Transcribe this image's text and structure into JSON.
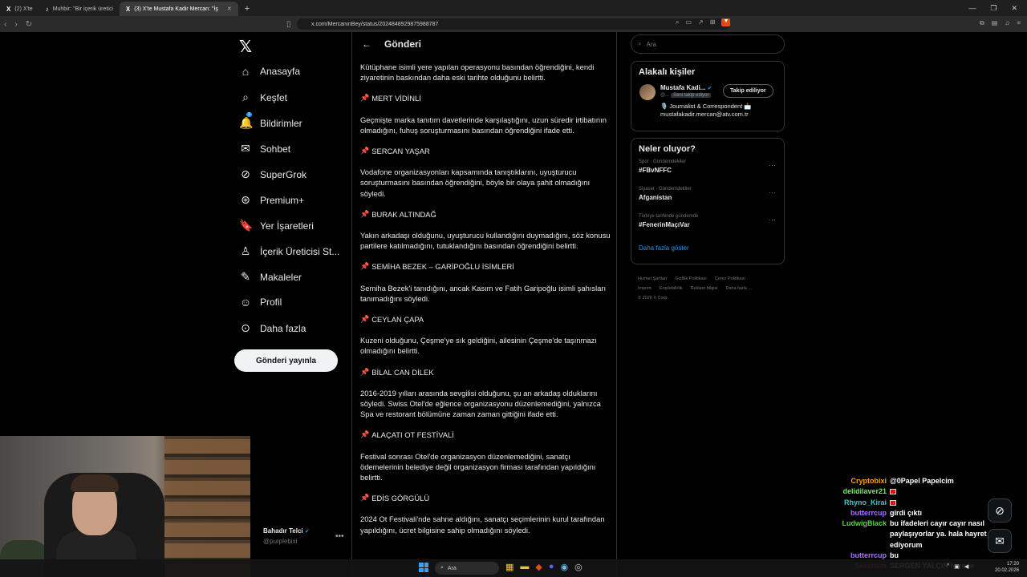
{
  "browser": {
    "tabs": [
      {
        "label": "(2) X'te",
        "active": false
      },
      {
        "label": "Muhbir: \"Bir içerik üretici",
        "active": false
      },
      {
        "label": "(3) X'te Mustafa Kadir Mercan: \"İş",
        "active": true
      }
    ],
    "url": "x.com/MercanınBey/status/2024848929875988787"
  },
  "sidebar": {
    "items": [
      {
        "label": "Anasayfa",
        "icon": "home-icon"
      },
      {
        "label": "Keşfet",
        "icon": "search-icon"
      },
      {
        "label": "Bildirimler",
        "icon": "bell-icon",
        "badge": "3"
      },
      {
        "label": "Sohbet",
        "icon": "mail-icon"
      },
      {
        "label": "SuperGrok",
        "icon": "grok-icon"
      },
      {
        "label": "Premium+",
        "icon": "premium-icon"
      },
      {
        "label": "Yer İşaretleri",
        "icon": "bookmark-icon"
      },
      {
        "label": "İçerik Üreticisi St...",
        "icon": "creator-icon"
      },
      {
        "label": "Makaleler",
        "icon": "article-icon"
      },
      {
        "label": "Profil",
        "icon": "profile-icon"
      },
      {
        "label": "Daha fazla",
        "icon": "more-icon"
      }
    ],
    "post_button": "Gönderi yayınla",
    "account": {
      "name": "Bahadır Telci",
      "handle": "@purplebixi"
    }
  },
  "main": {
    "header": "Gönderi",
    "blocks": [
      {
        "type": "p",
        "text": "Kütüphane isimli yere yapılan operasyonu basından öğrendiğini, kendi ziyaretinin baskından daha eski tarihte olduğunu belirtti."
      },
      {
        "type": "h",
        "text": "MERT VİDİNLİ"
      },
      {
        "type": "p",
        "text": "Geçmişte marka tanıtım davetlerinde karşılaştığını, uzun süredir irtibatının olmadığını, fuhuş soruşturmasını basından öğrendiğini ifade etti."
      },
      {
        "type": "h",
        "text": "SERCAN YAŞAR"
      },
      {
        "type": "p",
        "text": "Vodafone organizasyonları kapsamında tanıştıklarını, uyuşturucu soruşturmasını basından öğrendiğini, böyle bir olaya şahit olmadığını söyledi."
      },
      {
        "type": "h",
        "text": "BURAK ALTINDAĞ"
      },
      {
        "type": "p",
        "text": "Yakın arkadaşı olduğunu, uyuşturucu kullandığını duymadığını, söz konusu partilere katılmadığını, tutuklandığını basından öğrendiğini belirtti."
      },
      {
        "type": "h",
        "text": "SEMİHA BEZEK – GARİPOĞLU İSİMLERİ"
      },
      {
        "type": "p",
        "text": "Semiha Bezek'i tanıdığını, ancak Kasım ve Fatih Garipoğlu isimli şahısları tanımadığını söyledi."
      },
      {
        "type": "h",
        "text": "CEYLAN ÇAPA"
      },
      {
        "type": "p",
        "text": "Kuzeni olduğunu, Çeşme'ye sık geldiğini, ailesinin Çeşme'de taşınmazı olmadığını belirtti."
      },
      {
        "type": "h",
        "text": "BİLAL CAN DİLEK"
      },
      {
        "type": "p",
        "text": "2016-2019 yılları arasında sevgilisi olduğunu, şu an arkadaş olduklarını söyledi. Swiss Otel'de eğlence organizasyonu düzenlemediğini, yalnızca Spa ve restorant bölümüne zaman zaman gittiğini ifade etti."
      },
      {
        "type": "h",
        "text": "ALAÇATI OT FESTİVALİ"
      },
      {
        "type": "p",
        "text": "Festival sonrası Otel'de organizasyon düzenlemediğini, sanatçı ödemelerinin belediye değil organizasyon firması tarafından yapıldığını belirtti."
      },
      {
        "type": "h",
        "text": "EDİS GÖRGÜLÜ"
      },
      {
        "type": "p",
        "text": "2024 Ot Festivali'nde sahne aldığını, sanatçı seçimlerinin kurul tarafından yapıldığını, ücret bilgisine sahip olmadığını söyledi."
      }
    ]
  },
  "right": {
    "search_placeholder": "Ara",
    "related_title": "Alakalı kişiler",
    "person": {
      "name": "Mustafa Kadi...",
      "handle": "@...",
      "tag": "Seni takip ediyor",
      "follow_label": "Takip ediliyor",
      "bio_line1": "🎙️ Journalist & Correspondent 📩",
      "bio_line2": "mustafakadir.mercan@atv.com.tr"
    },
    "trends_title": "Neler oluyor?",
    "trends": [
      {
        "category": "Spor · Gündemdekiler",
        "name": "#FBvNFFC"
      },
      {
        "category": "Siyaset · Gündemdekiler",
        "name": "Afganistan"
      },
      {
        "category": "Türkiye tarihinde gündemde",
        "name": "#FenerinMaçıVar"
      }
    ],
    "show_more": "Daha fazla göster",
    "footer_line1": [
      "Hizmet Şartları",
      "Gizlilik Politikası",
      "Çerez Politikası"
    ],
    "footer_line2": [
      "Imprint",
      "Erişilebilirlik",
      "Reklam bilgisi",
      "Daha fazla ..."
    ],
    "copyright": "© 2026 X Corp."
  },
  "chat": [
    {
      "user": "Cryptobixi",
      "color": "#ff9f1c",
      "text": "@0Papel Papelcim",
      "flag": false
    },
    {
      "user": "delidilaver21",
      "color": "#7be36b",
      "text": "",
      "flag": true
    },
    {
      "user": "Rhyno_Kirai",
      "color": "#3fc6c6",
      "text": "",
      "flag": true
    },
    {
      "user": "butterrcup",
      "color": "#a970ff",
      "text": "girdi çıktı",
      "flag": false
    },
    {
      "user": "LudwigBlack",
      "color": "#56d43f",
      "text": "bu ifadeleri cayır cayır nasıl paylaşıyorlar ya. hala hayret ediyorum",
      "flag": false
    },
    {
      "user": "butterrcup",
      "color": "#a970ff",
      "text": "bu",
      "flag": false
    },
    {
      "user": "Sekerliim",
      "color": "#ff6a6a",
      "text": "SERGEN YALÇIN herede",
      "flag": false
    }
  ],
  "taskbar": {
    "search": "Ara",
    "time": "17:20",
    "date": "20.02.2026"
  }
}
